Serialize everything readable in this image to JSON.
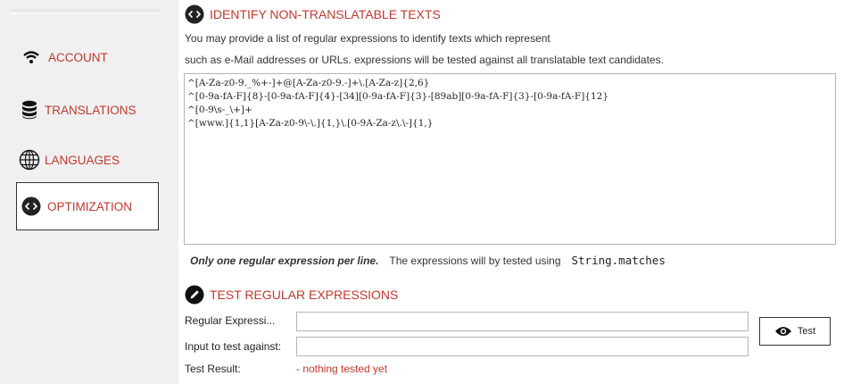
{
  "sidebar": {
    "items": [
      {
        "label": "ACCOUNT",
        "icon": "wifi-icon"
      },
      {
        "label": "TRANSLATIONS",
        "icon": "database-icon"
      },
      {
        "label": "LANGUAGES",
        "icon": "globe-icon"
      },
      {
        "label": "OPTIMIZATION",
        "icon": "code-brackets-icon",
        "active": true
      }
    ]
  },
  "identify": {
    "title": "IDENTIFY NON-TRANSLATABLE TEXTS",
    "desc_line1": "You may provide a list of regular expressions to identify texts which represent",
    "desc_line2": "such as e-Mail addresses or URLs. expressions will be tested against all translatable text candidates.",
    "expressions": "^[A-Za-z0-9._%+-]+@[A-Za-z0-9.-]+\\.[A-Za-z]{2,6}\n^[0-9a-fA-F]{8}-[0-9a-fA-F]{4}-[34][0-9a-fA-F]{3}-[89ab][0-9a-fA-F]{3}-[0-9a-fA-F]{12}\n^[0-9\\s-_\\+]+\n^[www.]{1,1}[A-Za-z0-9\\-\\.]{1,}\\.[0-9A-Za-z\\.\\-]{1,}",
    "note_bold": "Only one regular expression per line.",
    "note_text": "The expressions will by tested using",
    "note_code": "String.matches"
  },
  "test": {
    "title": "TEST REGULAR EXPRESSIONS",
    "regex_label": "Regular Expressi...",
    "regex_value": "",
    "input_label": "Input to test against:",
    "input_value": "",
    "result_label": "Test Result:",
    "result_value": "- nothing tested yet",
    "button_label": "Test"
  },
  "colors": {
    "accent": "#c0392b",
    "sidebar_bg": "#f0f0f0",
    "border": "#333333"
  }
}
